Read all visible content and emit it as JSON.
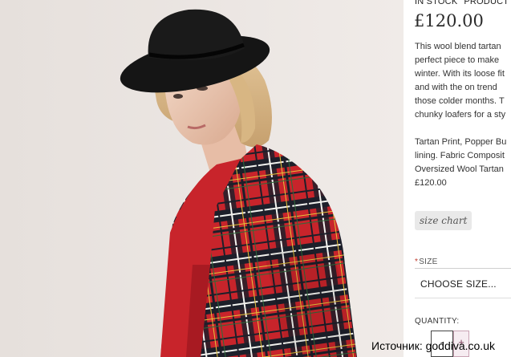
{
  "product": {
    "stock_status": "IN STOCK",
    "product_label": "PRODUCT",
    "price": "£120.00",
    "description_lines": [
      "This wool blend tartan",
      "perfect piece to make",
      "winter. With its loose fit",
      "and with the on trend",
      "those colder months. T",
      "chunky loafers for a sty"
    ],
    "detail_lines": [
      "Tartan Print, Popper Bu",
      "lining. Fabric Composit",
      "Oversized Wool Tartan",
      "£120.00"
    ]
  },
  "size_chart": {
    "label": "size chart"
  },
  "size": {
    "required_mark": "*",
    "label": "SIZE",
    "selected": "CHOOSE SIZE..."
  },
  "quantity": {
    "label": "QUANTITY:",
    "decrease_symbol": "-",
    "increase_symbol": "+"
  },
  "watermark": {
    "text": "Источник: goddiva.co.uk"
  },
  "photo": {
    "subject": "model-in-red-tartan-coat-and-black-hat",
    "colors": {
      "coat_red": "#c8242b",
      "hat": "#141414",
      "background": "#ece6e2"
    }
  }
}
